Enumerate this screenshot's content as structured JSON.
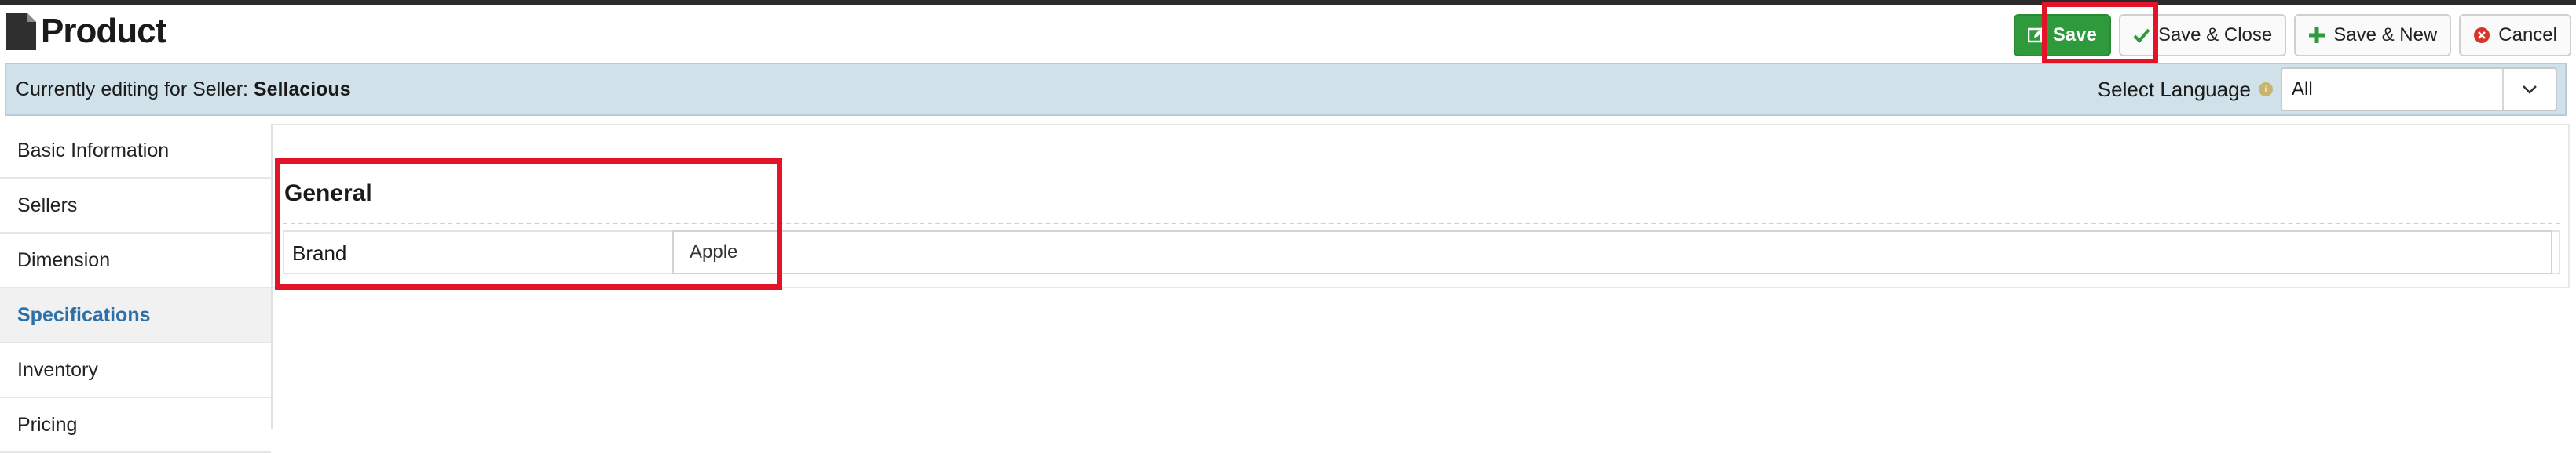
{
  "header": {
    "title": "Product",
    "title_icon": "file-icon"
  },
  "toolbar": {
    "save_label": "Save",
    "save_close_label": "Save & Close",
    "save_new_label": "Save & New",
    "cancel_label": "Cancel"
  },
  "seller_bar": {
    "prefix": "Currently editing for Seller:",
    "seller_name": "Sellacious",
    "language_label": "Select Language",
    "language_value": "All"
  },
  "sidebar": {
    "items": [
      {
        "label": "Basic Information"
      },
      {
        "label": "Sellers"
      },
      {
        "label": "Dimension"
      },
      {
        "label": "Specifications"
      },
      {
        "label": "Inventory"
      },
      {
        "label": "Pricing"
      }
    ],
    "active_index": 3
  },
  "form": {
    "section_title": "General",
    "fields": [
      {
        "label": "Brand",
        "value": "Apple"
      }
    ]
  },
  "colors": {
    "primary_button": "#2e9a3b",
    "highlight": "#e3142a",
    "seller_bar_bg": "#d0e1ea",
    "active_link": "#2d6fa8"
  }
}
